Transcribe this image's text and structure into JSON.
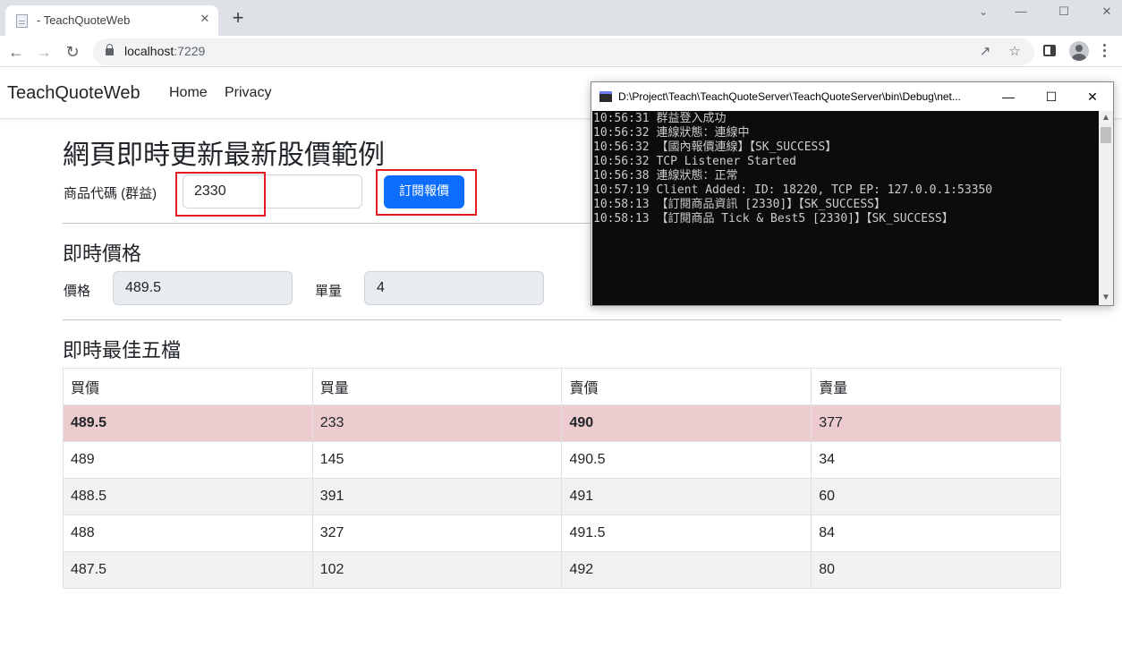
{
  "browser": {
    "tab_title": "- TeachQuoteWeb",
    "tab_close_glyph": "✕",
    "new_tab_glyph": "+",
    "url_host": "localhost",
    "url_port": ":7229",
    "icons": [
      "back-arrow-icon",
      "forward-arrow-icon",
      "reload-icon",
      "lock-icon",
      "share-icon",
      "star-icon",
      "side-panel-icon",
      "profile-icon",
      "more-menu-icon"
    ]
  },
  "site": {
    "brand": "TeachQuoteWeb",
    "nav": [
      "Home",
      "Privacy"
    ]
  },
  "page": {
    "title": "網頁即時更新最新股價範例",
    "symbol_label": "商品代碼 (群益)",
    "symbol_value": "2330",
    "subscribe_label": "訂閱報價",
    "highlight_color": "#e31b23",
    "accent_color": "#0d6efd"
  },
  "realtime": {
    "title": "即時價格",
    "price_label": "價格",
    "price_value": "489.5",
    "volume_label": "單量",
    "volume_value": "4"
  },
  "best5": {
    "title": "即時最佳五檔",
    "headers": [
      "買價",
      "買量",
      "賣價",
      "賣量"
    ],
    "rows": [
      [
        "489.5",
        "233",
        "490",
        "377"
      ],
      [
        "489",
        "145",
        "490.5",
        "34"
      ],
      [
        "488.5",
        "391",
        "491",
        "60"
      ],
      [
        "488",
        "327",
        "491.5",
        "84"
      ],
      [
        "487.5",
        "102",
        "492",
        "80"
      ]
    ],
    "top_row_color": "#eccccf"
  },
  "console": {
    "title": "D:\\Project\\Teach\\TeachQuoteServer\\TeachQuoteServer\\bin\\Debug\\net...",
    "lines": [
      "10:56:31 群益登入成功",
      "10:56:32 連線狀態：連線中",
      "10:56:32 【國內報價連線】【SK_SUCCESS】",
      "10:56:32 TCP Listener Started",
      "10:56:38 連線狀態：正常",
      "10:57:19 Client Added: ID: 18220, TCP EP: 127.0.0.1:53350",
      "10:58:13 【訂閱商品資訊 [2330]】【SK_SUCCESS】",
      "10:58:13 【訂閱商品 Tick & Best5 [2330]】【SK_SUCCESS】"
    ]
  }
}
